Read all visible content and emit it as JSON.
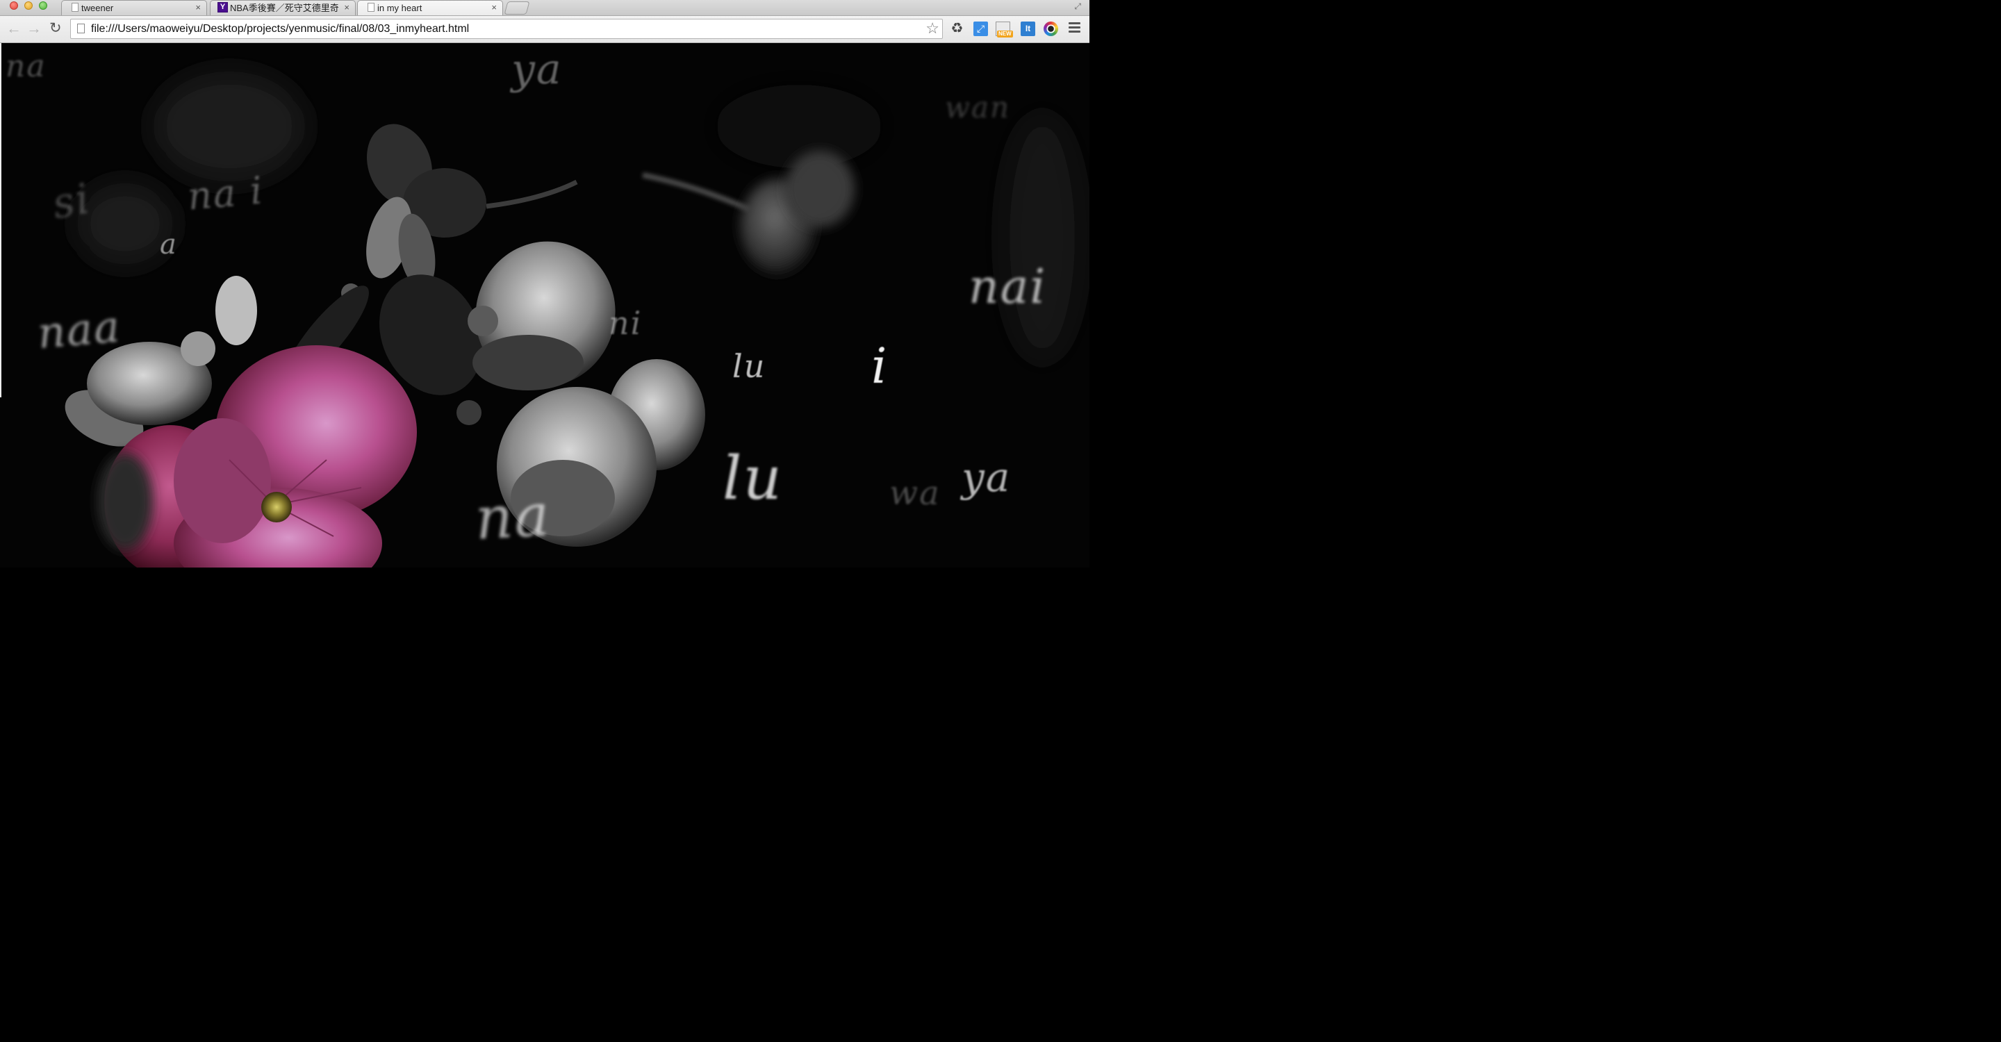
{
  "browser": {
    "tabs": [
      {
        "label": "tweener",
        "close": "×"
      },
      {
        "label": "NBA季後賽／死守艾德里奇",
        "close": "×",
        "favicon_text": "Y"
      },
      {
        "label": "in my heart",
        "close": "×"
      }
    ],
    "url": "file:///Users/maoweiyu/Desktop/projects/yenmusic/final/08/03_inmyheart.html",
    "extension_badge": "NEW",
    "extension_it": "It"
  },
  "page": {
    "lyrics": [
      {
        "text": "na",
        "size": 44,
        "opacity": 0.3,
        "blur": 1.5
      },
      {
        "text": "ya",
        "size": 60,
        "opacity": 0.38,
        "blur": 1
      },
      {
        "text": "wan",
        "size": 42,
        "opacity": 0.22,
        "blur": 2
      },
      {
        "text": "si",
        "size": 60,
        "opacity": 0.25,
        "blur": 2
      },
      {
        "text": "na i",
        "size": 54,
        "opacity": 0.35,
        "blur": 1.5
      },
      {
        "text": "a",
        "size": 40,
        "opacity": 0.55,
        "blur": 0.5
      },
      {
        "text": "naa",
        "size": 62,
        "opacity": 0.6,
        "blur": 2.5
      },
      {
        "text": "nai",
        "size": 68,
        "opacity": 0.7,
        "blur": 2
      },
      {
        "text": "ni",
        "size": 46,
        "opacity": 0.45,
        "blur": 1
      },
      {
        "text": "lu",
        "size": 46,
        "opacity": 0.75,
        "blur": 0.5
      },
      {
        "text": "i",
        "size": 70,
        "opacity": 0.95,
        "blur": 0.5
      },
      {
        "text": "lu",
        "size": 86,
        "opacity": 0.8,
        "blur": 1.5
      },
      {
        "text": "wa",
        "size": 48,
        "opacity": 0.28,
        "blur": 1.5
      },
      {
        "text": "ya",
        "size": 58,
        "opacity": 0.7,
        "blur": 1
      },
      {
        "text": "na",
        "size": 84,
        "opacity": 0.65,
        "blur": 2.5
      }
    ]
  }
}
